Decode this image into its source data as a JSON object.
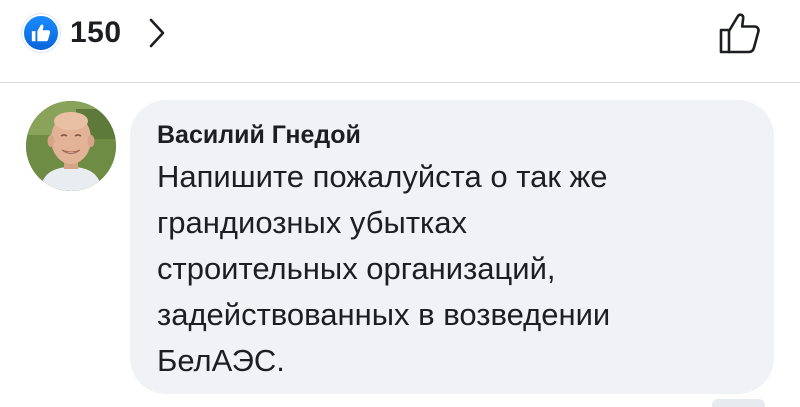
{
  "reactions": {
    "icon": "thumbs-up-icon",
    "count": "150",
    "chevron_icon": "chevron-right-icon",
    "like_action_icon": "thumbs-up-outline-icon",
    "badge_color": "#1877f2"
  },
  "comment": {
    "author": "Василий Гнедой",
    "text": "Напишите пожалуйста о так же\nграндиозных убытках\nстроительных организаций,\nзадействованных в возведении\nБелАЭС.",
    "avatar_icon": "avatar",
    "bubble_color": "#f0f2f5"
  }
}
